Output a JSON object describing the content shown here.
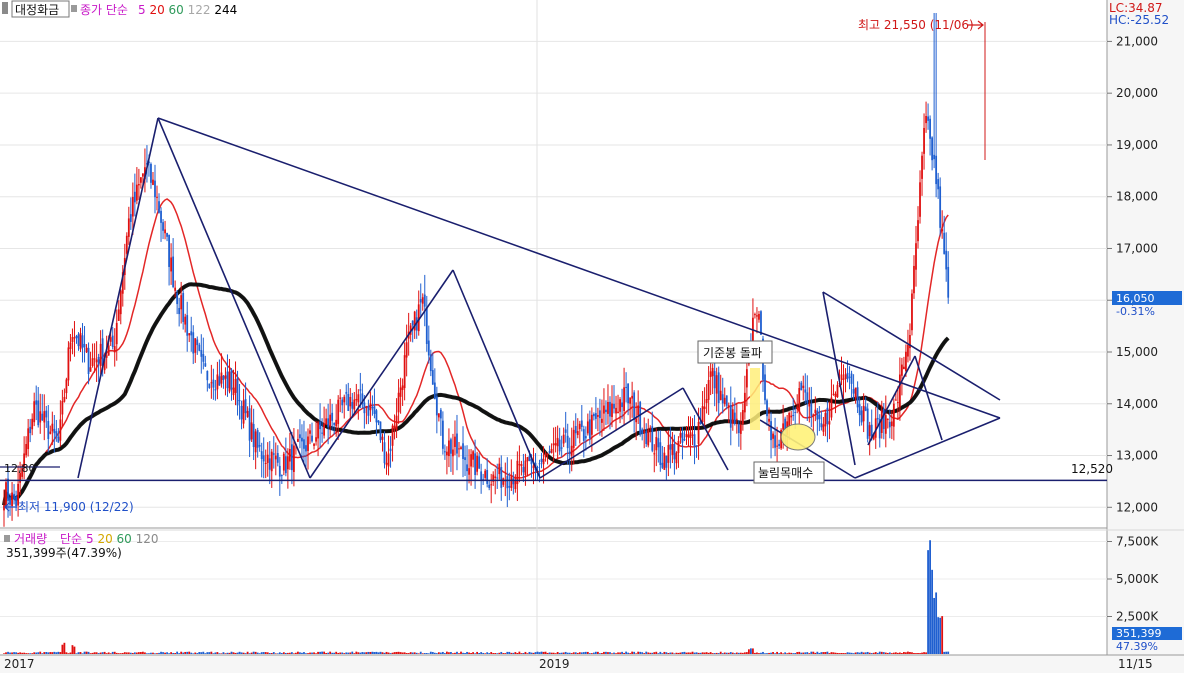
{
  "header": {
    "stock_name": "대정화금",
    "price_legend": "종가 단순",
    "ma_periods": [
      "5",
      "20",
      "60",
      "122",
      "244"
    ],
    "ma_colors": [
      "#c81ac8",
      "#e01010",
      "#2e9a5a",
      "#a8a8a8",
      "#000000"
    ],
    "lc_label": "LC:34.87",
    "hc_label": "HC:-25.52"
  },
  "volume_header": {
    "title": "거래량",
    "legend": "단순",
    "ma_periods": [
      "5",
      "20",
      "60",
      "120"
    ],
    "ma_colors": [
      "#c81ac8",
      "#d4a800",
      "#2e9a5a",
      "#8a8a8a"
    ],
    "current_volume": "351,399주(47.39%)"
  },
  "annotations": {
    "high_label": "최고 21,550 (11/06)",
    "low_label": "최저 11,900 (12/22)",
    "support_label": "12,520",
    "box_breakout": "기준봉 돌파",
    "box_pullback": "눌림목매수",
    "left_partial_label": "12,80"
  },
  "current": {
    "price_tag": "16,050",
    "change_pct": "-0.31%",
    "volume_tag": "351,399",
    "volume_pct": "47.39%"
  },
  "colors": {
    "up": "#e01010",
    "down": "#1f5fd0",
    "trendline": "#1a1f6e",
    "label_blue": "#2050c8",
    "label_red": "#d01818",
    "tag_bg": "#1e6bd6",
    "axis_bg": "#f4f4f4",
    "highlight_yellow": "#ffef7a"
  },
  "chart_data": {
    "type": "candlestick",
    "x_axis_labels": [
      "2017",
      "2019",
      "11/15"
    ],
    "price_axis": {
      "ticks": [
        "12,000",
        "13,000",
        "14,000",
        "15,000",
        "16,000",
        "17,000",
        "18,000",
        "19,000",
        "20,000",
        "21,000"
      ],
      "ylim": [
        11600,
        21800
      ]
    },
    "volume_axis": {
      "ticks": [
        "2,500K",
        "5,000K",
        "7,500K"
      ],
      "ylim": [
        0,
        8200
      ]
    },
    "price_path_anchors": [
      {
        "t": 0,
        "p": 12300
      },
      {
        "t": 0.012,
        "p": 12100
      },
      {
        "t": 0.03,
        "p": 13950
      },
      {
        "t": 0.055,
        "p": 13200
      },
      {
        "t": 0.068,
        "p": 15500
      },
      {
        "t": 0.085,
        "p": 14800
      },
      {
        "t": 0.11,
        "p": 15100
      },
      {
        "t": 0.125,
        "p": 17500
      },
      {
        "t": 0.142,
        "p": 18600
      },
      {
        "t": 0.152,
        "p": 18100
      },
      {
        "t": 0.175,
        "p": 16000
      },
      {
        "t": 0.2,
        "p": 14600
      },
      {
        "t": 0.23,
        "p": 14400
      },
      {
        "t": 0.255,
        "p": 13100
      },
      {
        "t": 0.28,
        "p": 12800
      },
      {
        "t": 0.3,
        "p": 13150
      },
      {
        "t": 0.35,
        "p": 14100
      },
      {
        "t": 0.37,
        "p": 13900
      },
      {
        "t": 0.385,
        "p": 12900
      },
      {
        "t": 0.405,
        "p": 15100
      },
      {
        "t": 0.42,
        "p": 16000
      },
      {
        "t": 0.44,
        "p": 13300
      },
      {
        "t": 0.49,
        "p": 12550
      },
      {
        "t": 0.53,
        "p": 12750
      },
      {
        "t": 0.58,
        "p": 13400
      },
      {
        "t": 0.625,
        "p": 14150
      },
      {
        "t": 0.66,
        "p": 12950
      },
      {
        "t": 0.695,
        "p": 13400
      },
      {
        "t": 0.71,
        "p": 14600
      },
      {
        "t": 0.725,
        "p": 13900
      },
      {
        "t": 0.74,
        "p": 13400
      },
      {
        "t": 0.755,
        "p": 16100
      },
      {
        "t": 0.77,
        "p": 13100
      },
      {
        "t": 0.8,
        "p": 14300
      },
      {
        "t": 0.82,
        "p": 13400
      },
      {
        "t": 0.845,
        "p": 14800
      },
      {
        "t": 0.87,
        "p": 13400
      },
      {
        "t": 0.895,
        "p": 13900
      },
      {
        "t": 0.91,
        "p": 15500
      },
      {
        "t": 0.925,
        "p": 19500
      },
      {
        "t": 0.935,
        "p": 18500
      },
      {
        "t": 0.948,
        "p": 16050
      }
    ],
    "trend_levels": {
      "high": 21550,
      "low": 11900,
      "support": 12520,
      "last_close": 16050
    },
    "volume_spikes": [
      {
        "t": 0.06,
        "v": 800
      },
      {
        "t": 0.07,
        "v": 600
      },
      {
        "t": 0.75,
        "v": 400
      },
      {
        "t": 0.93,
        "v": 7600
      },
      {
        "t": 0.935,
        "v": 4200
      },
      {
        "t": 0.94,
        "v": 2800
      }
    ]
  }
}
